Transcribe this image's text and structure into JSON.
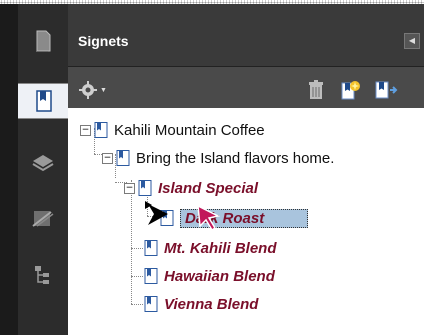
{
  "panel": {
    "title": "Signets",
    "collapse_icon": "triangle-left-icon"
  },
  "rail": {
    "buttons": [
      "pages-icon",
      "bookmarks-icon",
      "layers-icon",
      "signatures-icon",
      "model-tree-icon"
    ],
    "active": "bookmarks-icon"
  },
  "toolbar": {
    "options_icon": "gear-icon",
    "delete_icon": "trash-icon",
    "new_icon": "new-bookmark-icon",
    "expand_icon": "expand-bookmark-icon"
  },
  "tree": {
    "items": [
      {
        "label": "Kahili Mountain Coffee",
        "style": "normal"
      },
      {
        "label": "Bring the Island flavors home.",
        "style": "normal"
      },
      {
        "label": "Island Special",
        "style": "red"
      },
      {
        "label": "Dark Roast",
        "style": "red",
        "selected": true
      },
      {
        "label": "Mt. Kahili Blend",
        "style": "red"
      },
      {
        "label": "Hawaiian Blend",
        "style": "red"
      },
      {
        "label": "Vienna Blend",
        "style": "red"
      }
    ]
  },
  "colors": {
    "bookmark_red": "#7a0f2a",
    "selection": "#a9c4dd",
    "dark_ui": "#3a3a3a"
  }
}
